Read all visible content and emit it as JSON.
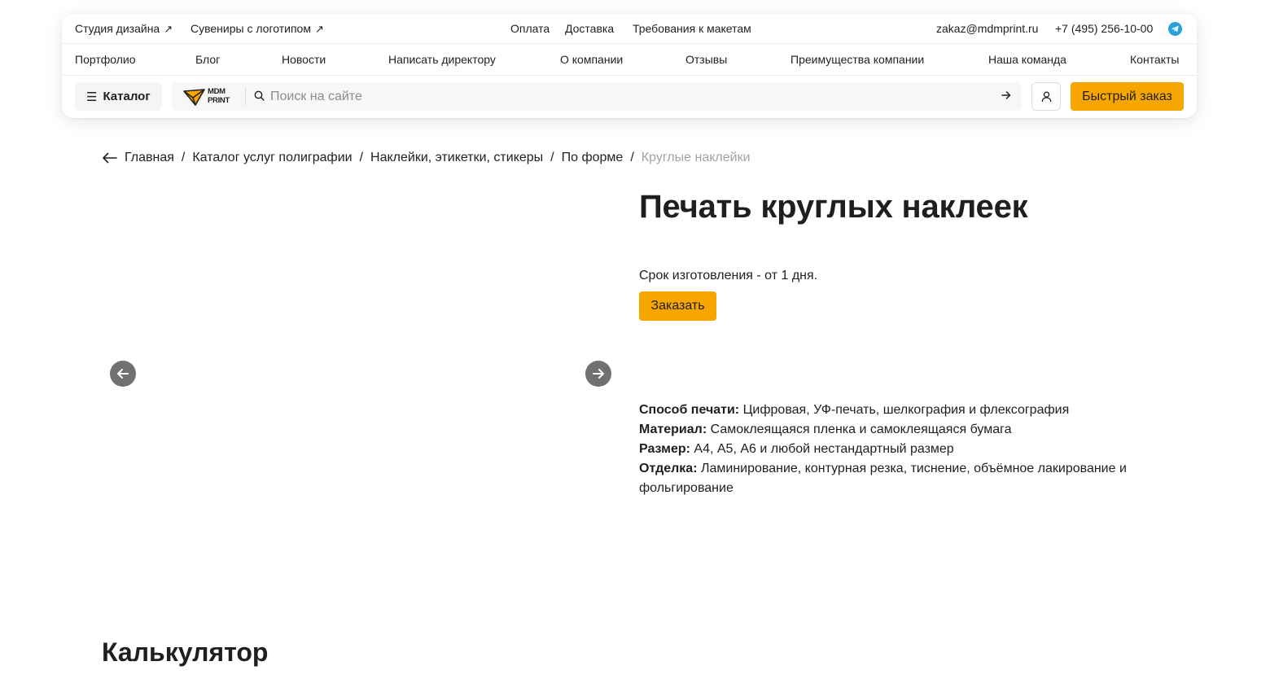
{
  "topbar": {
    "links_left": [
      {
        "label": "Студия дизайна",
        "arrow": "↗"
      },
      {
        "label": "Сувениры с логотипом",
        "arrow": "↗"
      }
    ],
    "links_center": [
      "Оплата",
      "Доставка",
      "Требования к макетам"
    ],
    "email": "zakaz@mdmprint.ru",
    "phone": "+7 (495) 256-10-00",
    "telegram_icon": "telegram-icon"
  },
  "nav": {
    "items": [
      "Портфолио",
      "Блог",
      "Новости",
      "Написать директору",
      "О компании",
      "Отзывы",
      "Преимущества компании",
      "Наша команда",
      "Контакты"
    ]
  },
  "toolbar": {
    "catalog_icon": "☰",
    "catalog_label": "Каталог",
    "logo_line1": "MDM",
    "logo_line2": "PRINT",
    "search_placeholder": "Поиск на сайте",
    "quick_order_label": "Быстрый заказ"
  },
  "breadcrumb": {
    "items": [
      "Главная",
      "Каталог услуг полиграфии",
      "Наклейки, этикетки, стикеры",
      "По форме"
    ],
    "separator": "/",
    "current": "Круглые наклейки"
  },
  "product": {
    "title": "Печать круглых наклеек",
    "lead_time": "Срок изготовления - от 1 дня.",
    "order_label": "Заказать",
    "specs": [
      {
        "label": "Способ печати:",
        "value": "Цифровая, УФ-печать, шелкография и флексография"
      },
      {
        "label": "Материал:",
        "value": "Самоклеящаяся пленка и самоклеящаяся бумага"
      },
      {
        "label": "Размер:",
        "value": "А4, А5, А6 и любой нестандартный размер"
      },
      {
        "label": "Отделка:",
        "value": "Ламинирование, контурная резка, тиснение, объёмное лакирование и фольгирование"
      }
    ]
  },
  "calculator": {
    "title": "Калькулятор"
  },
  "colors": {
    "accent": "#f7a600",
    "muted": "#a3a3a3",
    "telegram": "#2aa1da"
  }
}
